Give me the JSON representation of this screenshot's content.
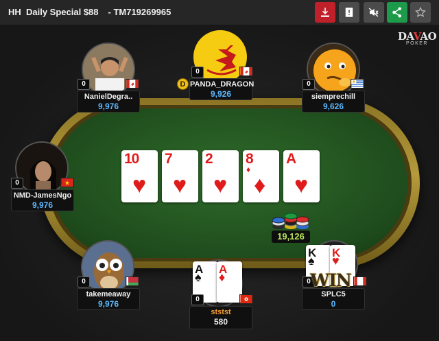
{
  "header": {
    "title": "HH  Daily Special $88",
    "hand_id": "- TM719269965",
    "buttons": [
      {
        "name": "download",
        "icon": "download-icon",
        "color": "#c0202a"
      },
      {
        "name": "report",
        "icon": "flag-icon",
        "color": "#4b4b4b"
      },
      {
        "name": "mute",
        "icon": "mute-icon",
        "color": "#4b4b4b"
      },
      {
        "name": "share",
        "icon": "share-icon",
        "color": "#1d9a4a"
      },
      {
        "name": "favorite",
        "icon": "star-icon",
        "color": "#4b4b4b"
      }
    ]
  },
  "brand": {
    "name_left": "DA",
    "name_v": "V",
    "name_right": "AO",
    "sub": "POKER"
  },
  "board": [
    {
      "rank": "10",
      "suit": "♥",
      "color": "red"
    },
    {
      "rank": "7",
      "suit": "♥",
      "color": "red"
    },
    {
      "rank": "2",
      "suit": "♥",
      "color": "red"
    },
    {
      "rank": "8",
      "suit": "♦",
      "color": "red"
    },
    {
      "rank": "A",
      "suit": "♥",
      "color": "red"
    }
  ],
  "pot": "19,126",
  "dealer_button": "D",
  "players": [
    {
      "seat": "top-left",
      "name": "NanielDegra..",
      "stack": "9,976",
      "bet": "0",
      "flag": "Canada"
    },
    {
      "seat": "top-center",
      "name": "PANDA_DRAGON",
      "stack": "9,926",
      "bet": "0",
      "flag": "Canada"
    },
    {
      "seat": "top-right",
      "name": "siemprechill",
      "stack": "9,626",
      "bet": "0",
      "flag": "Uruguay"
    },
    {
      "seat": "left",
      "name": "NMD-JamesNgo",
      "stack": "9,976",
      "bet": "0",
      "flag": "Vietnam"
    },
    {
      "seat": "bottom-left",
      "name": "takemeaway",
      "stack": "9,976",
      "bet": "0",
      "flag": "Belarus"
    },
    {
      "seat": "bottom-center",
      "name": "ststst",
      "stack": "580",
      "bet": "0",
      "flag": "Hong Kong",
      "cards": [
        {
          "rank": "A",
          "suit": "♠",
          "color": "black"
        },
        {
          "rank": "A",
          "suit": "♦",
          "color": "red"
        }
      ]
    },
    {
      "seat": "bottom-right",
      "name": "SPLC5",
      "stack": "0",
      "bet": "0",
      "flag": "Canada",
      "cards": [
        {
          "rank": "K",
          "suit": "♠",
          "color": "black"
        },
        {
          "rank": "K",
          "suit": "♥",
          "color": "red"
        }
      ],
      "badge": "WIN"
    }
  ]
}
